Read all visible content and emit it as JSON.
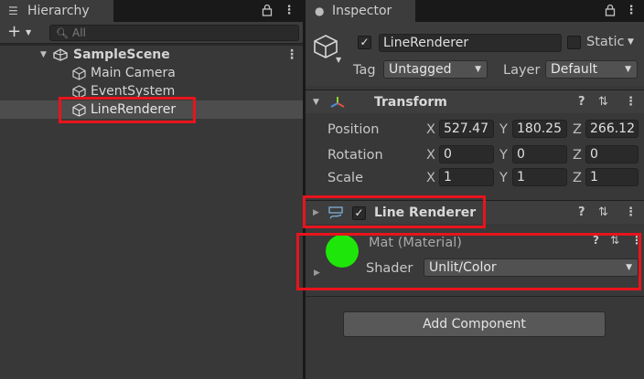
{
  "hierarchy": {
    "tab_label": "Hierarchy",
    "tab_icon": "hamburger-list-icon",
    "add_button": "+",
    "search_placeholder": "All",
    "scene_name": "SampleScene",
    "items": [
      {
        "label": "Main Camera",
        "icon": "gameobject-cube-icon"
      },
      {
        "label": "EventSystem",
        "icon": "gameobject-cube-icon"
      },
      {
        "label": "LineRenderer",
        "icon": "gameobject-cube-icon",
        "selected": true
      }
    ]
  },
  "inspector": {
    "tab_label": "Inspector",
    "object_name": "LineRenderer",
    "active": true,
    "static_label": "Static",
    "static_checked": false,
    "tag_label": "Tag",
    "tag_value": "Untagged",
    "layer_label": "Layer",
    "layer_value": "Default",
    "transform": {
      "title": "Transform",
      "position_label": "Position",
      "rotation_label": "Rotation",
      "scale_label": "Scale",
      "position": {
        "x": "527.47",
        "y": "180.25",
        "z": "266.12"
      },
      "rotation": {
        "x": "0",
        "y": "0",
        "z": "0"
      },
      "scale": {
        "x": "1",
        "y": "1",
        "z": "1"
      },
      "x_label": "X",
      "y_label": "Y",
      "z_label": "Z"
    },
    "line_renderer": {
      "title": "Line Renderer",
      "enabled": true
    },
    "material": {
      "name": "Mat (Material)",
      "shader_label": "Shader",
      "shader_value": "Unlit/Color",
      "swatch_color": "#1ee60a"
    },
    "add_component_label": "Add Component"
  },
  "colors": {
    "highlight": "#e8141c",
    "selection_row": "#4d4d4d"
  }
}
